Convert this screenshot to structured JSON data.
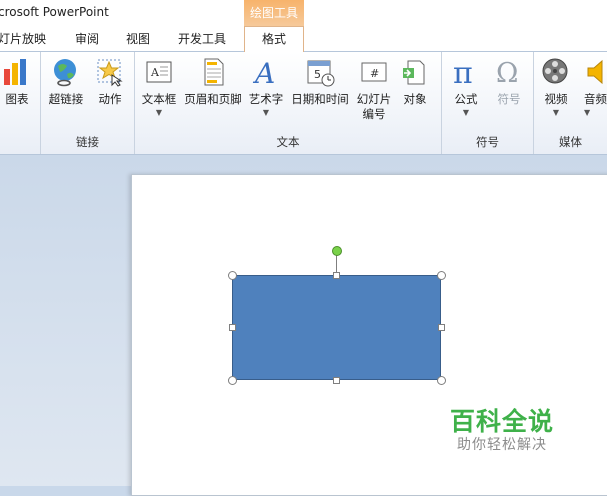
{
  "window": {
    "title": "crosoft PowerPoint"
  },
  "context_group": {
    "label": "绘图工具"
  },
  "tabs": [
    {
      "label": "灯片放映"
    },
    {
      "label": "审阅"
    },
    {
      "label": "视图"
    },
    {
      "label": "开发工具"
    },
    {
      "label": "格式"
    }
  ],
  "ribbon": {
    "buttons": {
      "chart": "图表",
      "hyperlink": "超链接",
      "action": "动作",
      "textbox": "文本框",
      "header_footer": "页眉和页脚",
      "wordart": "艺术字",
      "datetime": "日期和时间",
      "slide_number_line1": "幻灯片",
      "slide_number_line2": "编号",
      "object": "对象",
      "equation": "公式",
      "symbol": "符号",
      "video": "视频",
      "audio": "音频"
    },
    "groups": {
      "links": "链接",
      "text": "文本",
      "symbols": "符号",
      "media": "媒体"
    }
  },
  "watermark": {
    "title": "百科全说",
    "subtitle": "助你轻松解决"
  },
  "colors": {
    "shape_fill": "#4f81bd",
    "accent_orange": "#f7b36b",
    "watermark_green": "#3fb14a"
  }
}
